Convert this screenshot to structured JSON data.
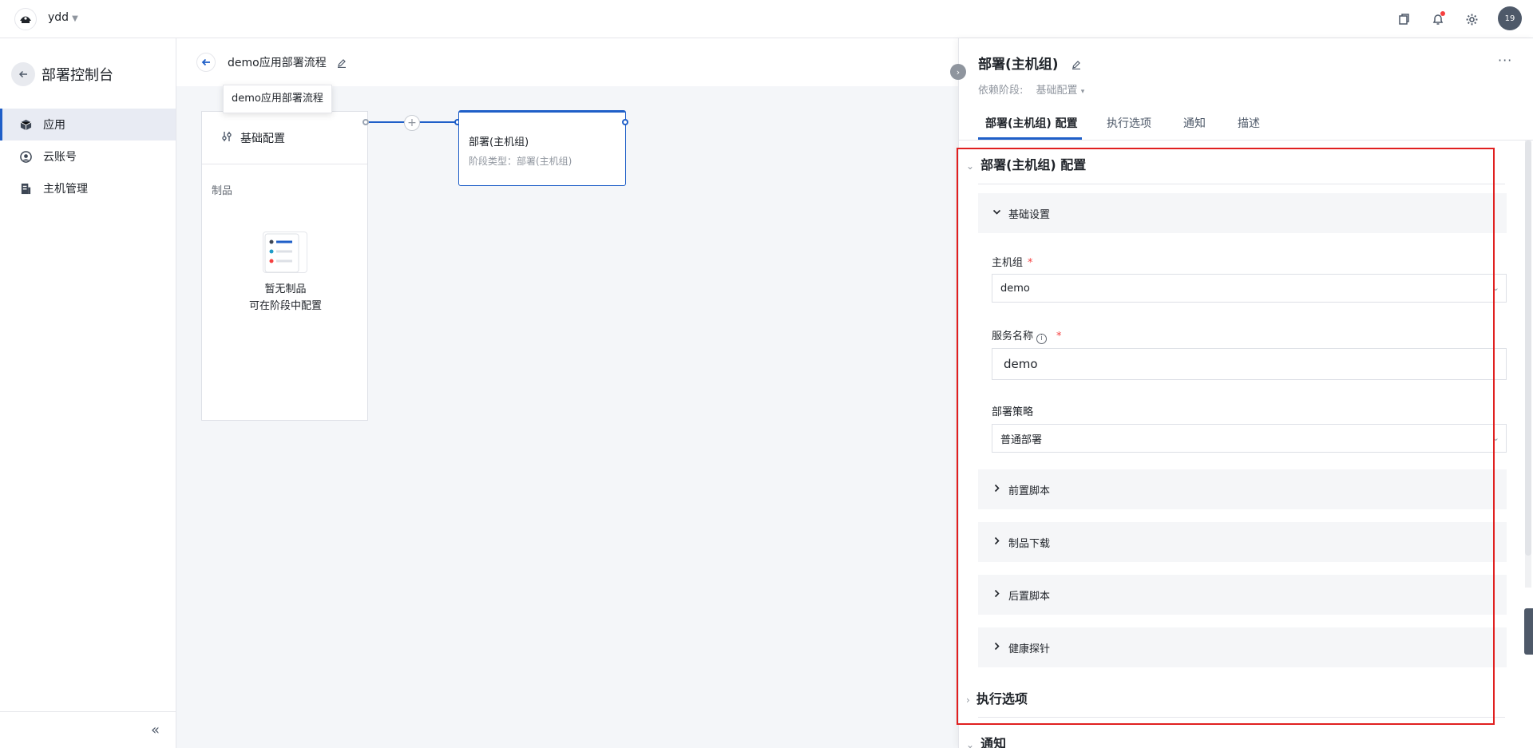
{
  "topbar": {
    "org_name": "ydd",
    "avatar_text": "19"
  },
  "sidebar": {
    "title": "部署控制台",
    "items": [
      {
        "label": "应用",
        "icon": "cube-icon",
        "active": true
      },
      {
        "label": "云账号",
        "icon": "user-circle-icon",
        "active": false
      },
      {
        "label": "主机管理",
        "icon": "server-icon",
        "active": false
      }
    ],
    "collapse_symbol": "«"
  },
  "canvas": {
    "flow_title": "demo应用部署流程",
    "tooltip": "demo应用部署流程",
    "stage1": {
      "title": "基础配置",
      "section": "制品",
      "empty_line1": "暂无制品",
      "empty_line2": "可在阶段中配置"
    },
    "stage2": {
      "title": "部署(主机组)",
      "subtitle": "阶段类型：部署(主机组)"
    },
    "plus": "+"
  },
  "panel": {
    "title": "部署(主机组)",
    "more": "···",
    "dependency_label": "依赖阶段:",
    "dependency_value": "基础配置",
    "tabs": [
      "部署(主机组) 配置",
      "执行选项",
      "通知",
      "描述"
    ],
    "section_config": "部署(主机组) 配置",
    "basic_settings": "基础设置",
    "host_group_label": "主机组",
    "host_group_value": "demo",
    "service_name_label": "服务名称",
    "service_name_value": "demo",
    "strategy_label": "部署策略",
    "strategy_value": "普通部署",
    "collapsed": [
      "前置脚本",
      "制品下载",
      "后置脚本",
      "健康探针"
    ],
    "section_exec": "执行选项",
    "section_notify": "通知",
    "required_mark": "*",
    "info_mark": "i"
  },
  "colors": {
    "accent": "#1f5fc8",
    "highlight": "#e02020",
    "notification_dot": "#f53f3f"
  }
}
